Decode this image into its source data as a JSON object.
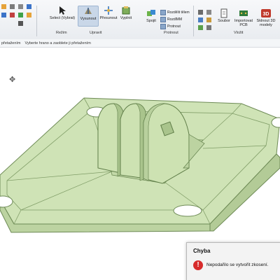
{
  "ribbon": {
    "buttons": {
      "select": "Select (Vybrat)",
      "extrude": "Vysunout",
      "move": "Přesunout",
      "fill": "Vyplnit",
      "combine": "Spojit",
      "file": "Soubor",
      "import_pcb": "Importovat PCB",
      "3d_models": "Sklnout 3D modely"
    },
    "intersect_items": [
      "Rozdělit tělem",
      "RozdlMM",
      "Protnout"
    ],
    "groups": {
      "mode": "Režim",
      "edit": "Upravit",
      "intersect": "Protnout",
      "insert": "Vložit"
    },
    "badge_3d": "3D"
  },
  "hint_bar": {
    "part1": "přetažením",
    "part2": "Vyberte hrano a zaoblete ji přetažením"
  },
  "error_dialog": {
    "title": "Chyba",
    "message": "Nepodařilo se vytvořit zkosení."
  },
  "colors": {
    "model_fill": "#cfe3b6",
    "model_stroke": "#6d8a55",
    "error_red": "#d72b2b",
    "ribbon_bg": "#eceff3"
  },
  "icons": [
    "select-icon",
    "extrude-icon",
    "move-icon",
    "fill-icon",
    "combine-icon",
    "file-icon",
    "pcb-icon",
    "3d-models-icon",
    "move-cursor-icon",
    "error-icon"
  ]
}
